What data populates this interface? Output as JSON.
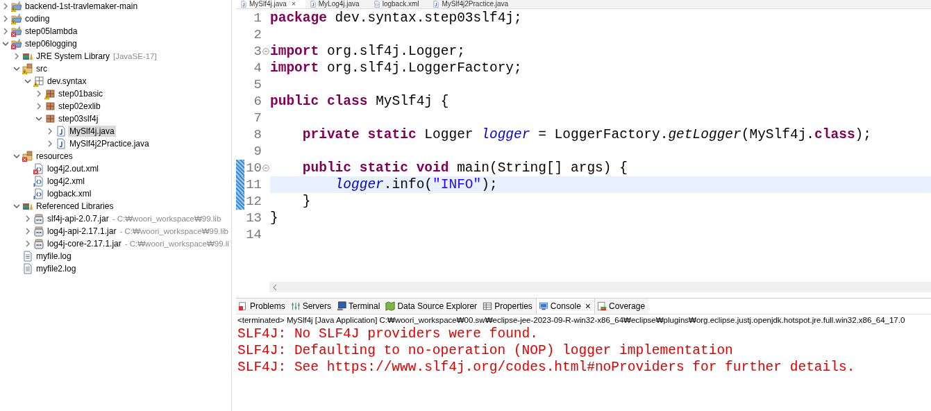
{
  "explorer": {
    "items": [
      {
        "label": "backend-1st-travlemaker-main",
        "kind": "project",
        "warning": true,
        "error": false,
        "info": false,
        "expanded": false,
        "selected": false
      },
      {
        "label": "coding",
        "kind": "project",
        "warning": true,
        "error": false,
        "info": false,
        "expanded": false,
        "selected": false
      },
      {
        "label": "step05lambda",
        "kind": "project",
        "warning": false,
        "error": true,
        "info": false,
        "expanded": false,
        "selected": false
      },
      {
        "label": "step06logging",
        "kind": "project",
        "warning": false,
        "error": true,
        "info": false,
        "expanded": true,
        "selected": false,
        "children": [
          {
            "label": "JRE System Library",
            "qualifier": "[JavaSE-17]",
            "kind": "library",
            "warning": false,
            "error": false,
            "info": false,
            "expanded": false,
            "selected": false
          },
          {
            "label": "src",
            "kind": "source-folder",
            "warning": true,
            "error": false,
            "info": false,
            "expanded": true,
            "selected": false,
            "children": [
              {
                "label": "dev.syntax",
                "kind": "package-root",
                "warning": true,
                "error": false,
                "info": false,
                "expanded": true,
                "selected": false,
                "children": [
                  {
                    "label": "step01basic",
                    "kind": "package",
                    "warning": true,
                    "error": false,
                    "info": false,
                    "expanded": false,
                    "selected": false
                  },
                  {
                    "label": "step02exlib",
                    "kind": "package",
                    "warning": false,
                    "error": false,
                    "info": false,
                    "expanded": false,
                    "selected": false
                  },
                  {
                    "label": "step03slf4j",
                    "kind": "package",
                    "warning": false,
                    "error": false,
                    "info": false,
                    "expanded": true,
                    "selected": false,
                    "children": [
                      {
                        "label": "MySlf4j.java",
                        "kind": "java",
                        "warning": false,
                        "error": false,
                        "info": false,
                        "expanded": false,
                        "selected": true
                      },
                      {
                        "label": "MySlf4j2Practice.java",
                        "kind": "java",
                        "warning": false,
                        "error": false,
                        "info": false,
                        "expanded": false,
                        "selected": false
                      }
                    ]
                  }
                ]
              }
            ]
          },
          {
            "label": "resources",
            "kind": "source-folder",
            "warning": false,
            "error": true,
            "info": false,
            "expanded": true,
            "selected": false,
            "children": [
              {
                "label": "log4j2.out.xml",
                "kind": "xml",
                "warning": false,
                "error": true,
                "info": false,
                "selected": false
              },
              {
                "label": "log4j2.xml",
                "kind": "xml",
                "warning": false,
                "error": false,
                "info": true,
                "selected": false
              },
              {
                "label": "logback.xml",
                "kind": "xml",
                "warning": false,
                "error": false,
                "info": true,
                "selected": false
              }
            ]
          },
          {
            "label": "Referenced Libraries",
            "kind": "library",
            "warning": false,
            "error": false,
            "info": false,
            "expanded": true,
            "selected": false,
            "children": [
              {
                "label": "slf4j-api-2.0.7.jar",
                "qualifier": "- C:₩woori_workspace₩99.lib",
                "kind": "jar",
                "warning": false,
                "error": false,
                "info": false,
                "expanded": false,
                "selected": false
              },
              {
                "label": "log4j-api-2.17.1.jar",
                "qualifier": "- C:₩woori_workspace₩99.lib",
                "kind": "jar",
                "warning": false,
                "error": false,
                "info": false,
                "expanded": false,
                "selected": false
              },
              {
                "label": "log4j-core-2.17.1.jar",
                "qualifier": "- C:₩woori_workspace₩99.li",
                "kind": "jar",
                "warning": false,
                "error": false,
                "info": false,
                "expanded": false,
                "selected": false
              }
            ]
          },
          {
            "label": "myfile.log",
            "kind": "log",
            "warning": false,
            "error": false,
            "info": false,
            "selected": false
          },
          {
            "label": "myfile2.log",
            "kind": "log",
            "warning": false,
            "error": false,
            "info": false,
            "selected": false
          }
        ]
      }
    ]
  },
  "editor": {
    "tabs": [
      {
        "label": "MySlf4j.java",
        "kind": "java",
        "selected": true,
        "close": "×"
      },
      {
        "label": "MyLog4j.java",
        "kind": "java",
        "selected": false
      },
      {
        "label": "logback.xml",
        "kind": "xml",
        "selected": false
      },
      {
        "label": "MySlf4j2Practice.java",
        "kind": "java",
        "selected": false
      }
    ],
    "lines": [
      {
        "number": "1",
        "fold": false,
        "changed": false,
        "current": false,
        "tokens": [
          {
            "kind": "keyword",
            "text": "package"
          },
          {
            "kind": "plain",
            "text": " dev.syntax.step03slf4j;"
          }
        ]
      },
      {
        "number": "2",
        "fold": false,
        "changed": false,
        "current": false
      },
      {
        "number": "3",
        "fold": true,
        "changed": false,
        "current": false,
        "tokens": [
          {
            "kind": "keyword",
            "text": "import"
          },
          {
            "kind": "plain",
            "text": " org.slf4j.Logger;"
          }
        ]
      },
      {
        "number": "4",
        "fold": false,
        "changed": false,
        "current": false,
        "tokens": [
          {
            "kind": "keyword",
            "text": "import"
          },
          {
            "kind": "plain",
            "text": " org.slf4j.LoggerFactory;"
          }
        ]
      },
      {
        "number": "5",
        "fold": false,
        "changed": false,
        "current": false
      },
      {
        "number": "6",
        "fold": false,
        "changed": false,
        "current": false,
        "tokens": [
          {
            "kind": "keyword",
            "text": "public class"
          },
          {
            "kind": "plain",
            "text": " MySlf4j {"
          }
        ]
      },
      {
        "number": "7",
        "fold": false,
        "changed": false,
        "current": false
      },
      {
        "number": "8",
        "fold": false,
        "changed": false,
        "current": false,
        "tokens": [
          {
            "kind": "keyword",
            "text": "    private static"
          },
          {
            "kind": "plain",
            "text": " Logger "
          },
          {
            "kind": "field",
            "text": "logger"
          },
          {
            "kind": "plain",
            "text": " = LoggerFactory."
          },
          {
            "kind": "static-method",
            "text": "getLogger"
          },
          {
            "kind": "plain",
            "text": "(MySlf4j."
          },
          {
            "kind": "keyword",
            "text": "class"
          },
          {
            "kind": "plain",
            "text": ");"
          }
        ]
      },
      {
        "number": "9",
        "fold": false,
        "changed": false,
        "current": false
      },
      {
        "number": "10",
        "fold": true,
        "changed": true,
        "current": false,
        "tokens": [
          {
            "kind": "keyword",
            "text": "    public static void"
          },
          {
            "kind": "plain",
            "text": " main(String[] args) {"
          }
        ]
      },
      {
        "number": "11",
        "fold": false,
        "changed": true,
        "current": true,
        "tokens": [
          {
            "kind": "field",
            "text": "        logger"
          },
          {
            "kind": "plain",
            "text": ".info("
          },
          {
            "kind": "string",
            "text": "\"INFO\""
          },
          {
            "kind": "plain",
            "text": ");"
          }
        ]
      },
      {
        "number": "12",
        "fold": false,
        "changed": true,
        "current": false,
        "tokens": [
          {
            "kind": "plain",
            "text": "    }"
          }
        ]
      },
      {
        "number": "13",
        "fold": false,
        "changed": false,
        "current": false,
        "tokens": [
          {
            "kind": "plain",
            "text": "}"
          }
        ]
      },
      {
        "number": "14",
        "fold": false,
        "changed": false,
        "current": false
      }
    ]
  },
  "console": {
    "tabs": [
      {
        "label": "Problems",
        "kind": "problems",
        "selected": false
      },
      {
        "label": "Servers",
        "kind": "servers",
        "selected": false
      },
      {
        "label": "Terminal",
        "kind": "terminal",
        "selected": false
      },
      {
        "label": "Data Source Explorer",
        "kind": "data-source",
        "selected": false
      },
      {
        "label": "Properties",
        "kind": "properties",
        "selected": false
      },
      {
        "label": "Console",
        "kind": "console",
        "selected": true,
        "close": "×"
      },
      {
        "label": "Coverage",
        "kind": "coverage",
        "selected": false
      }
    ],
    "status": "<terminated> MySlf4j [Java Application] C:₩woori_workspace₩00.sw₩eclipse-jee-2023-09-R-win32-x86_64₩eclipse₩plugins₩org.eclipse.justj.openjdk.hotspot.jre.full.win32.x86_64_17.0",
    "output": [
      {
        "kind": "error",
        "text": "SLF4J: No SLF4J providers were found."
      },
      {
        "kind": "error",
        "text": "SLF4J: Defaulting to no-operation (NOP) logger implementation"
      },
      {
        "kind": "error",
        "text": "SLF4J: See https://www.slf4j.org/codes.html#noProviders for further details."
      }
    ]
  }
}
